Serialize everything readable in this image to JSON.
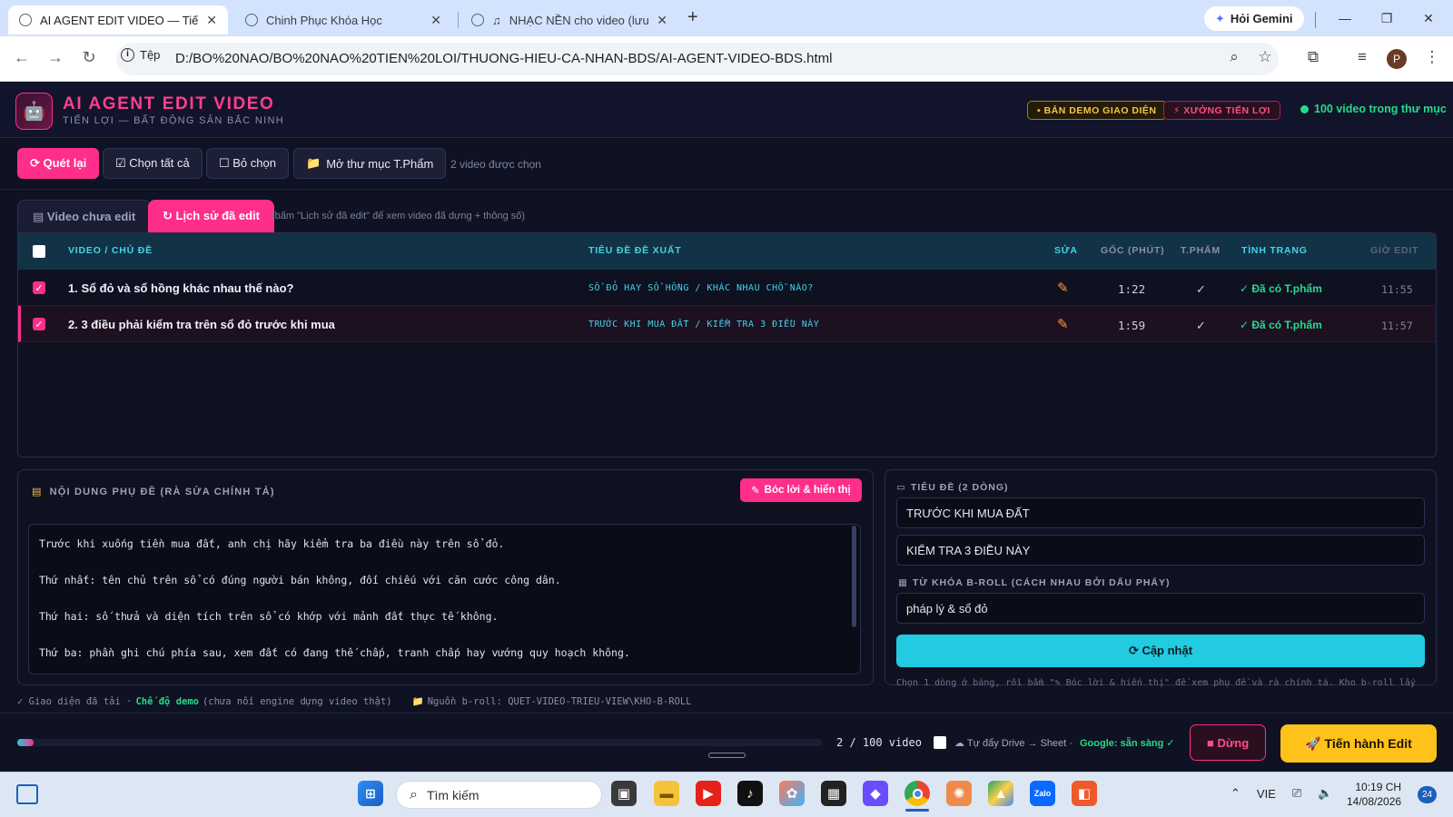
{
  "browser": {
    "tabs": [
      {
        "title": "AI AGENT EDIT VIDEO — Tiến L",
        "active": true
      },
      {
        "title": "Chinh Phục Khóa Học",
        "active": false
      },
      {
        "title": "NHẠC NỀN cho video (lưu t",
        "active": false
      }
    ],
    "gemini_label": "Hỏi Gemini",
    "file_chip": "Tệp",
    "url": "D:/BO%20NAO/BO%20NAO%20TIEN%20LOI/THUONG-HIEU-CA-NHAN-BDS/AI-AGENT-VIDEO-BDS.html",
    "profile_initial": "P"
  },
  "header": {
    "title": "AI AGENT EDIT VIDEO",
    "subtitle": "TIẾN LỢI — BẤT ĐỘNG SẢN BẮC NINH",
    "demo_badge": "• BẢN DEMO GIAO DIỆN",
    "workshop_badge": "⚡ XƯỞNG TIẾN LỢI",
    "video_count": "100 video trong thư mục"
  },
  "toolbar": {
    "rescan": "⟳ Quét lại",
    "select_all": "☑ Chọn tất cả",
    "deselect": "☐ Bỏ chọn",
    "open_folder": "Mở thư mục T.Phẩm",
    "selected_info": "2 video được chọn"
  },
  "tabs": {
    "unedited": "▤ Video chưa edit",
    "history": "↻ Lịch sử đã edit",
    "hint": "(bấm \"Lịch sử đã edit\" để xem video đã dựng + thông số)"
  },
  "table": {
    "headers": {
      "video": "VIDEO / CHỦ ĐỀ",
      "suggested": "TIÊU ĐỀ ĐỀ XUẤT",
      "edit": "SỬA",
      "duration": "GỐC (PHÚT)",
      "product": "T.PHẨM",
      "status": "TÌNH TRẠNG",
      "edit_time": "GIỜ EDIT"
    },
    "rows": [
      {
        "title": "1. Sổ đỏ và sổ hồng khác nhau thế nào?",
        "suggested": "SỔ ĐỎ HAY SỔ HỒNG / KHÁC NHAU CHỖ NÀO?",
        "duration": "1:22",
        "product": "✓",
        "status": "✓ Đã có T.phẩm",
        "time": "11:55"
      },
      {
        "title": "2. 3 điều phải kiểm tra trên sổ đỏ trước khi mua",
        "suggested": "TRƯỚC KHI MUA ĐẤT / KIỂM TRA 3 ĐIỀU NÀY",
        "duration": "1:59",
        "product": "✓",
        "status": "✓ Đã có T.phẩm",
        "time": "11:57"
      }
    ]
  },
  "subtitle_panel": {
    "title": "NỘI DUNG PHỤ ĐỀ (RÀ SỬA CHÍNH TẢ)",
    "extract_button": "Bóc lời & hiển thị",
    "lines": [
      "Trước khi xuống tiền mua đất, anh chị hãy kiểm tra ba điều này trên sổ đỏ.",
      "Thứ nhất: tên chủ trên sổ có đúng người bán không, đối chiếu với căn cước công dân.",
      "Thứ hai: số thửa và diện tích trên sổ có khớp với mảnh đất thực tế không.",
      "Thứ ba: phần ghi chú phía sau, xem đất có đang thế chấp, tranh chấp hay vướng quy hoạch không."
    ]
  },
  "title_panel": {
    "title_label": "TIÊU ĐỀ (2 DÒNG)",
    "line1": "TRƯỚC KHI MUA ĐẤT",
    "line2": "KIỂM TRA 3 ĐIỀU NÀY",
    "keyword_label": "TỪ KHÓA B-ROLL (CÁCH NHAU BỞI DẤU PHẨY)",
    "keywords": "pháp lý & sổ đỏ",
    "update_button": "⟳ Cập nhật",
    "hint": "Chọn 1 dòng ở bảng, rồi bấm \"✎ Bóc lời & hiển thị\" để xem phụ đề và rà chính tả. Kho b-roll lấy"
  },
  "footer": {
    "info_prefix": "✓ Giao diện đã tải ·",
    "demo_mode": "Chế độ demo",
    "info_suffix": "(chưa nối engine dựng video thật)",
    "broll_source": "Nguồn b-roll: QUET-VIDEO-TRIEU-VIEW\\KHO-B-ROLL",
    "progress_text": "2 / 100 video",
    "progress": 0.02,
    "auto_push": "☁ Tự đẩy Drive → Sheet ·",
    "google_status": "Google: sẵn sàng ✓",
    "stop": "■ Dừng",
    "go": "🚀 Tiến hành Edit"
  },
  "taskbar": {
    "search": "Tìm kiếm",
    "lang": "VIE",
    "time": "10:19 CH",
    "date": "14/08/2026",
    "notifications": "24"
  },
  "colors": {
    "accent": "#ff2e8a",
    "cyan": "#22cbe2",
    "green": "#27d98a",
    "gold": "#ffc21a"
  }
}
